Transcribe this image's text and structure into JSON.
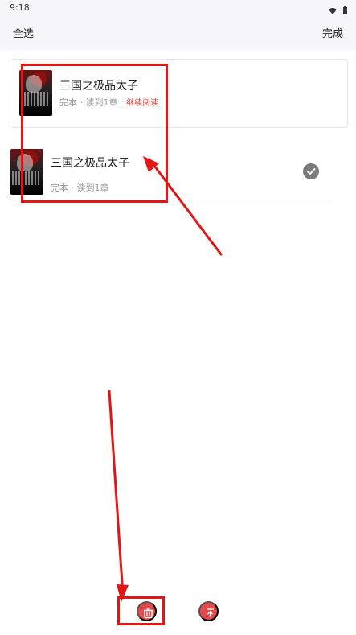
{
  "status": {
    "time": "9:18"
  },
  "header": {
    "select_all": "全选",
    "done": "完成"
  },
  "books": [
    {
      "title": "三国之极品太子",
      "meta": "完本 · 读到1章",
      "continue": "继续阅读"
    },
    {
      "title": "三国之极品太子",
      "meta": "完本 · 读到1章"
    }
  ],
  "actions": {
    "delete_icon": "trash-icon",
    "move_top_icon": "pin-to-top-icon"
  },
  "colors": {
    "accent": "#e34a4a",
    "annotation": "#e31616",
    "text": "#222222",
    "meta": "#999999"
  }
}
